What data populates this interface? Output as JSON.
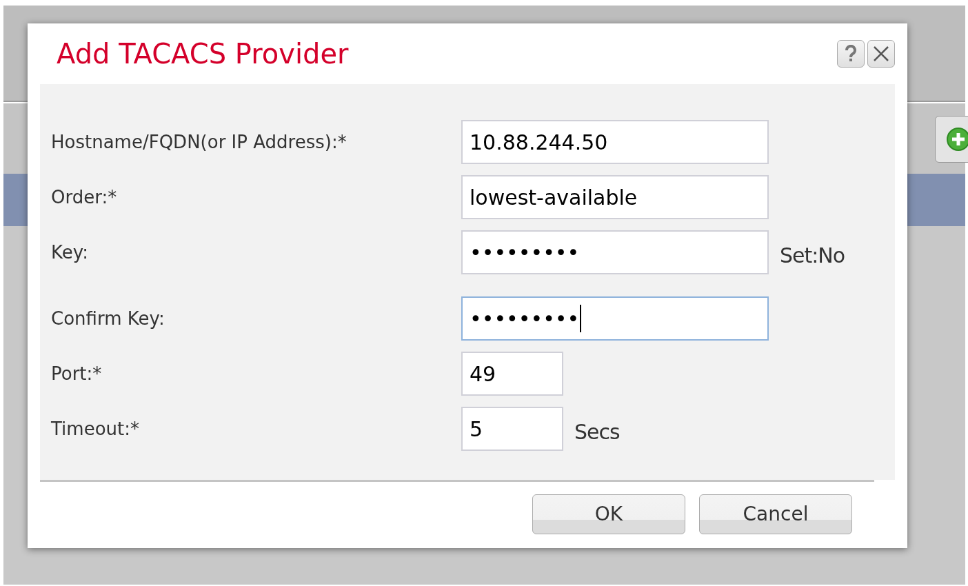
{
  "dialog": {
    "title": "Add TACACS Provider",
    "fields": [
      {
        "label": "Hostname/FQDN(or IP Address):*",
        "value": "10.88.244.50",
        "kind": "wide",
        "focused": false
      },
      {
        "label": "Order:*",
        "value": "lowest-available",
        "kind": "wide",
        "focused": false
      },
      {
        "label": "Key:",
        "value": "•••••••••",
        "kind": "wide",
        "focused": false,
        "suffix": "Set:No"
      },
      {
        "label": "Confirm Key:",
        "value": "•••••••••",
        "kind": "wide",
        "focused": true
      },
      {
        "label": "Port:*",
        "value": "49",
        "kind": "short",
        "focused": false
      },
      {
        "label": "Timeout:*",
        "value": "5",
        "kind": "short",
        "focused": false,
        "suffix": "Secs"
      }
    ],
    "buttons": [
      "OK",
      "Cancel"
    ]
  }
}
